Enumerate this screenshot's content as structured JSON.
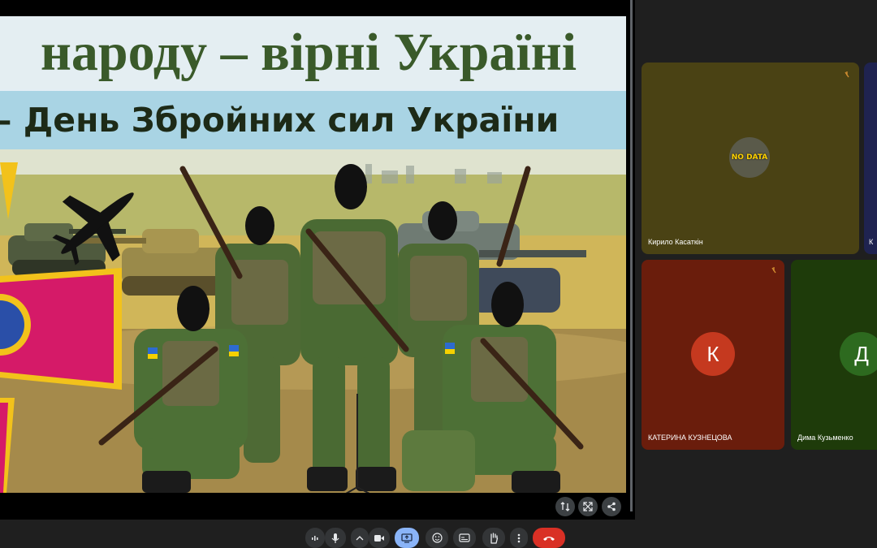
{
  "slide": {
    "title_line1": "народу – вірні Україні",
    "title_line2": "– День Збройних сил України"
  },
  "participants": [
    {
      "name": "Кирило Касаткін",
      "muted": true
    },
    {
      "name": "К",
      "muted": false
    },
    {
      "name": "КАТЕРИНА КУЗНЕЦОВА",
      "initial": "К",
      "muted": true,
      "color": "#c5391f"
    },
    {
      "name": "Дима Кузьменко",
      "initial": "Д",
      "muted": false,
      "color": "#2d6a1f"
    }
  ],
  "no_data_label": "NO DATA",
  "colors": {
    "tile_brown": "#4a4214",
    "tile_purple": "#1f2350",
    "tile_red": "#6a1d0c",
    "tile_green": "#1e3b0a",
    "end_call": "#d93025",
    "present_active": "#8ab4f8"
  },
  "stage_controls": [
    "swap-icon",
    "fullscreen-icon",
    "share-icon"
  ],
  "toolbar": [
    "audio-level-icon",
    "mic-icon",
    "chevron-up-icon",
    "camera-icon",
    "present-icon",
    "emoji-icon",
    "captions-icon",
    "raise-hand-icon",
    "more-icon",
    "end-call-icon"
  ]
}
